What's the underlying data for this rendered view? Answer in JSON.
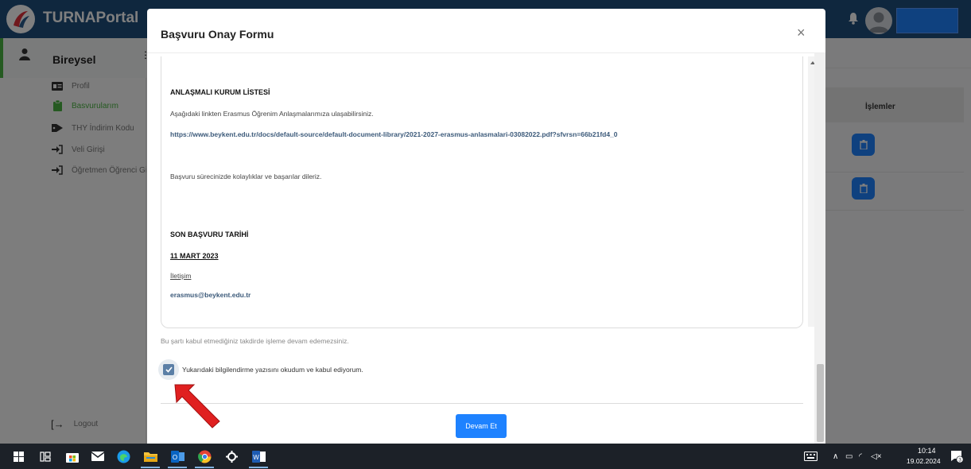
{
  "app": {
    "title": "TURNAPortal"
  },
  "sidebar": {
    "header": "Bireysel",
    "items": [
      {
        "label": "Profil",
        "icon": "id-card-icon",
        "active": false
      },
      {
        "label": "Basvurularım",
        "icon": "clipboard-icon",
        "active": true
      },
      {
        "label": "THY İndirim Kodu",
        "icon": "tag-icon",
        "active": false
      },
      {
        "label": "Veli Girişi",
        "icon": "sign-in-icon",
        "active": false
      },
      {
        "label": "Öğretmen Öğrenci Gir",
        "icon": "sign-in-icon",
        "active": false
      }
    ],
    "logout": "Logout"
  },
  "table": {
    "header_actions": "İşlemler"
  },
  "modal": {
    "title": "Başvuru Onay Formu",
    "close": "×",
    "content": {
      "section1_title": "ANLAŞMALI KURUM LİSTESİ",
      "section1_text": "Aşağıdaki linkten Erasmus Öğrenim Anlaşmalarımıza ulaşabilirsiniz.",
      "link": "https://www.beykent.edu.tr/docs/default-source/default-document-library/2021-2027-erasmus-anlasmalari-03082022.pdf?sfvrsn=66b21fd4_0",
      "wish": "Başvuru sürecinizde kolaylıklar ve başarılar dileriz.",
      "deadline_title": "SON BAŞVURU TARİHİ",
      "deadline_date": "11 MART 2023",
      "contact_label": "İletişim",
      "contact_email": "erasmus@beykent.edu.tr"
    },
    "warning": "Bu şartı kabul etmediğiniz takdirde işleme devam edemezsiniz.",
    "checkbox_label": "Yukarıdaki bilgilendirme yazısını okudum ve kabul ediyorum.",
    "checkbox_checked": true,
    "continue_button": "Devam Et"
  },
  "taskbar": {
    "time": "10:14",
    "date": "19.02.2024",
    "notifications": "3"
  },
  "colors": {
    "topbar": "#1f4e7d",
    "accent": "#1e82ff",
    "active_green": "#4bb543",
    "checkbox": "#5b7fa6",
    "arrow": "#e02020"
  }
}
